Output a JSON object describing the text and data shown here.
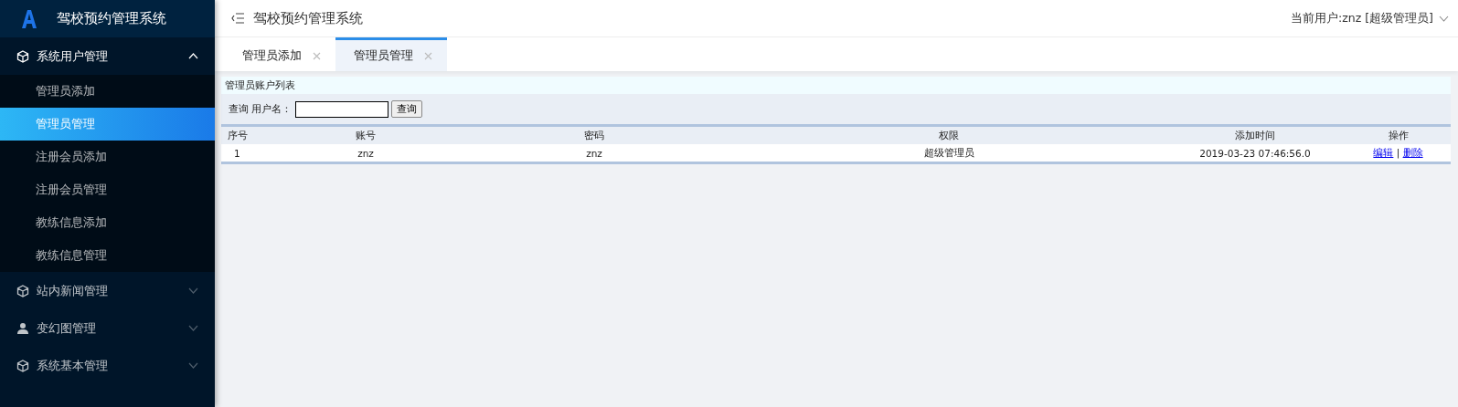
{
  "sidebar": {
    "title": "驾校预约管理系统",
    "groups": [
      {
        "label": "系统用户管理",
        "expanded": true,
        "children": [
          {
            "label": "管理员添加",
            "selected": false
          },
          {
            "label": "管理员管理",
            "selected": true
          },
          {
            "label": "注册会员添加",
            "selected": false
          },
          {
            "label": "注册会员管理",
            "selected": false
          },
          {
            "label": "教练信息添加",
            "selected": false
          },
          {
            "label": "教练信息管理",
            "selected": false
          }
        ]
      },
      {
        "label": "站内新闻管理",
        "expanded": false
      },
      {
        "label": "变幻图管理",
        "expanded": false
      },
      {
        "label": "系统基本管理",
        "expanded": false
      }
    ]
  },
  "header": {
    "title": "驾校预约管理系统",
    "user": "当前用户:znz [超级管理员]"
  },
  "tabs": [
    {
      "label": "管理员添加",
      "selected": false
    },
    {
      "label": "管理员管理",
      "selected": true
    }
  ],
  "panel": {
    "title": "管理员账户列表",
    "search": {
      "label": "查询 用户名：",
      "button": "查询"
    },
    "table": {
      "columns": [
        "序号",
        "账号",
        "密码",
        "权限",
        "添加时间",
        "操作"
      ],
      "rows": [
        {
          "cells": [
            "1",
            "znz",
            "znz",
            "超级管理员",
            "2019-03-23 07:46:56.0"
          ],
          "actions": [
            "编辑",
            "删除"
          ],
          "separator": "|"
        }
      ]
    }
  }
}
